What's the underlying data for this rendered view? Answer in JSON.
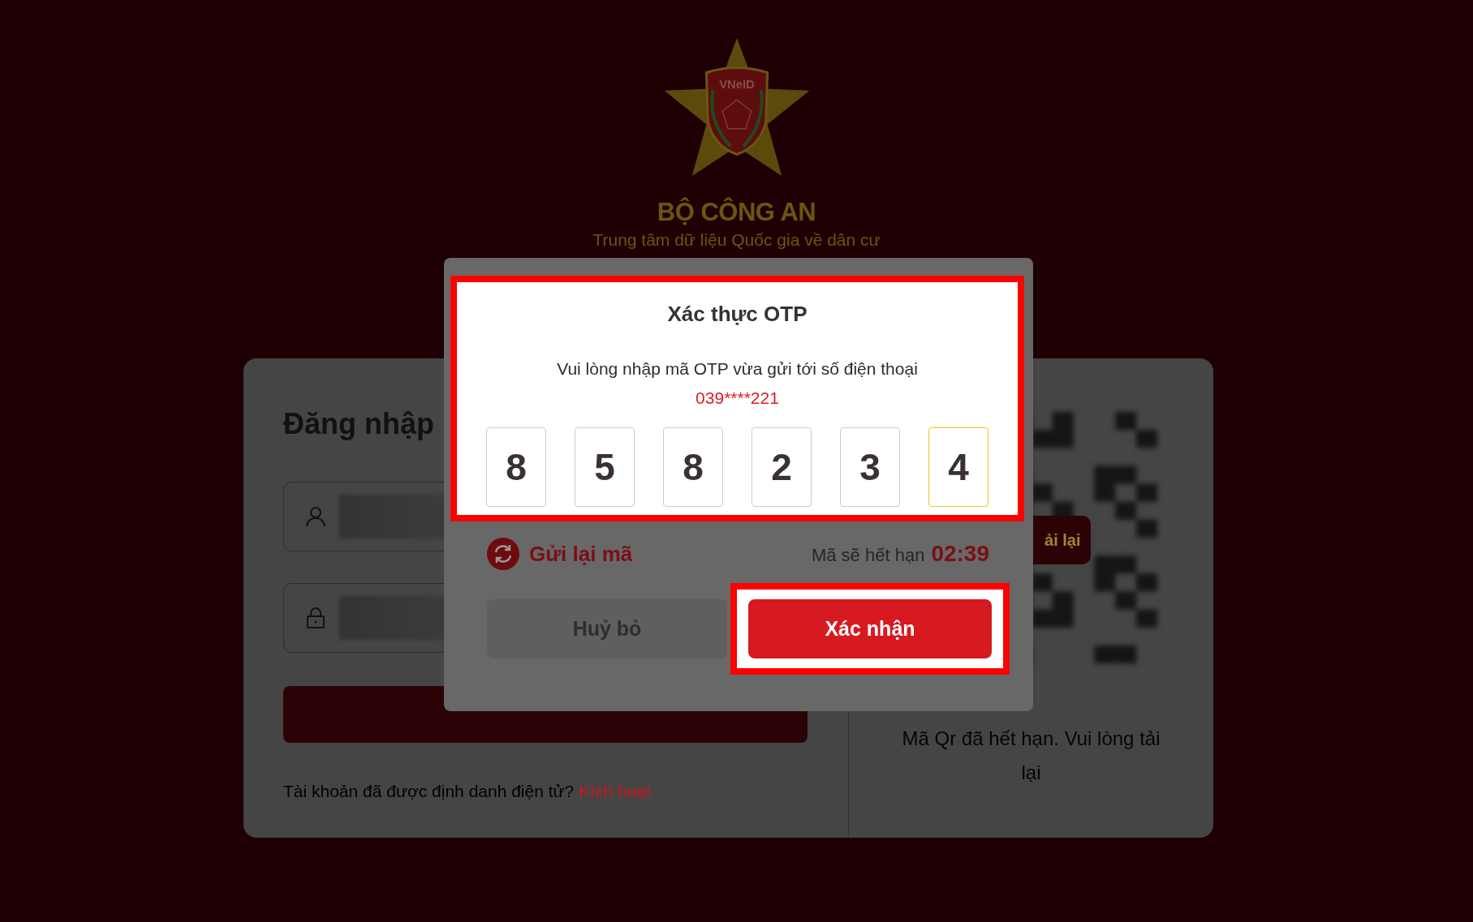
{
  "header": {
    "logo_text": "VNeID",
    "title": "BỘ CÔNG AN",
    "subtitle": "Trung tâm dữ liệu Quốc gia về dân cư"
  },
  "login": {
    "title": "Đăng nhập",
    "fields": [
      {
        "kind": "user"
      },
      {
        "kind": "password"
      }
    ],
    "footer_text": "Tài khoản đã được định danh điện tử?",
    "footer_link": "Kích hoạt"
  },
  "qr": {
    "reload_button": "ải lại",
    "message": "Mã Qr đã hết hạn. Vui lòng tải lại"
  },
  "otp_dialog": {
    "title": "Xác thực OTP",
    "message": "Vui lòng nhập mã OTP vừa gửi tới số điện thoại",
    "phone": "039****221",
    "digits": [
      {
        "value": "8",
        "focused": false
      },
      {
        "value": "5",
        "focused": false
      },
      {
        "value": "8",
        "focused": false
      },
      {
        "value": "2",
        "focused": false
      },
      {
        "value": "3",
        "focused": false
      },
      {
        "value": "4",
        "focused": true
      }
    ],
    "resend": "Gửi lại mã",
    "expiry_label": "Mã sẽ hết hạn",
    "expiry_time": "02:39",
    "cancel": "Huỷ bỏ",
    "confirm": "Xác nhận"
  }
}
